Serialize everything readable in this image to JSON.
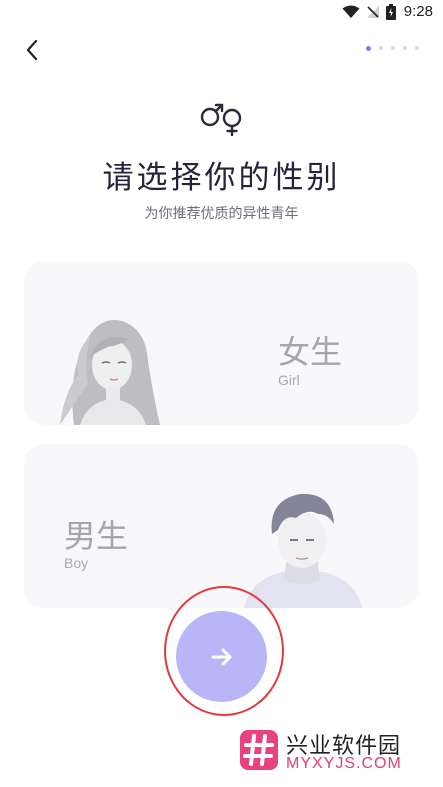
{
  "status_bar": {
    "time": "9:28"
  },
  "pager": {
    "total": 5,
    "active": 0
  },
  "header": {
    "title": "请选择你的性别",
    "subtitle": "为你推荐优质的异性青年"
  },
  "options": {
    "female": {
      "label": "女生",
      "sublabel": "Girl"
    },
    "male": {
      "label": "男生",
      "sublabel": "Boy"
    }
  },
  "colors": {
    "accent": "#b9b6f7",
    "active_dot": "#7d80e8",
    "card_bg": "#f8f8fa",
    "highlight_ring": "#e03b3b"
  },
  "icons": {
    "back": "chevron-left-icon",
    "gender": "gender-symbol-icon",
    "next": "arrow-right-icon"
  },
  "watermark": {
    "cn": "兴业软件园",
    "en": "MYXYJS.COM"
  }
}
